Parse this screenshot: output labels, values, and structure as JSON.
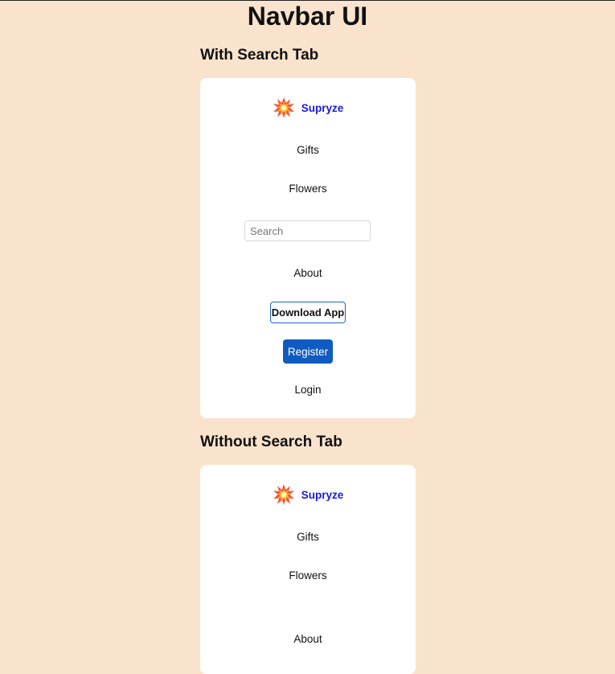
{
  "page": {
    "title": "Navbar UI"
  },
  "sections": [
    {
      "heading": "With Search Tab",
      "navbar": {
        "brand_icon": "collision-icon",
        "brand_name": "Supryze",
        "links": [
          "Gifts",
          "Flowers"
        ],
        "search_placeholder": "Search",
        "about": "About",
        "download_label": "Download App",
        "register_label": "Register",
        "login_label": "Login"
      }
    },
    {
      "heading": "Without Search Tab",
      "navbar": {
        "brand_icon": "collision-icon",
        "brand_name": "Supryze",
        "links": [
          "Gifts",
          "Flowers"
        ],
        "about": "About"
      }
    }
  ],
  "colors": {
    "background": "#fae3cd",
    "brand_text": "#1a1adc",
    "primary_button": "#0f5bc0",
    "outline_button_border": "#1a66c9"
  }
}
